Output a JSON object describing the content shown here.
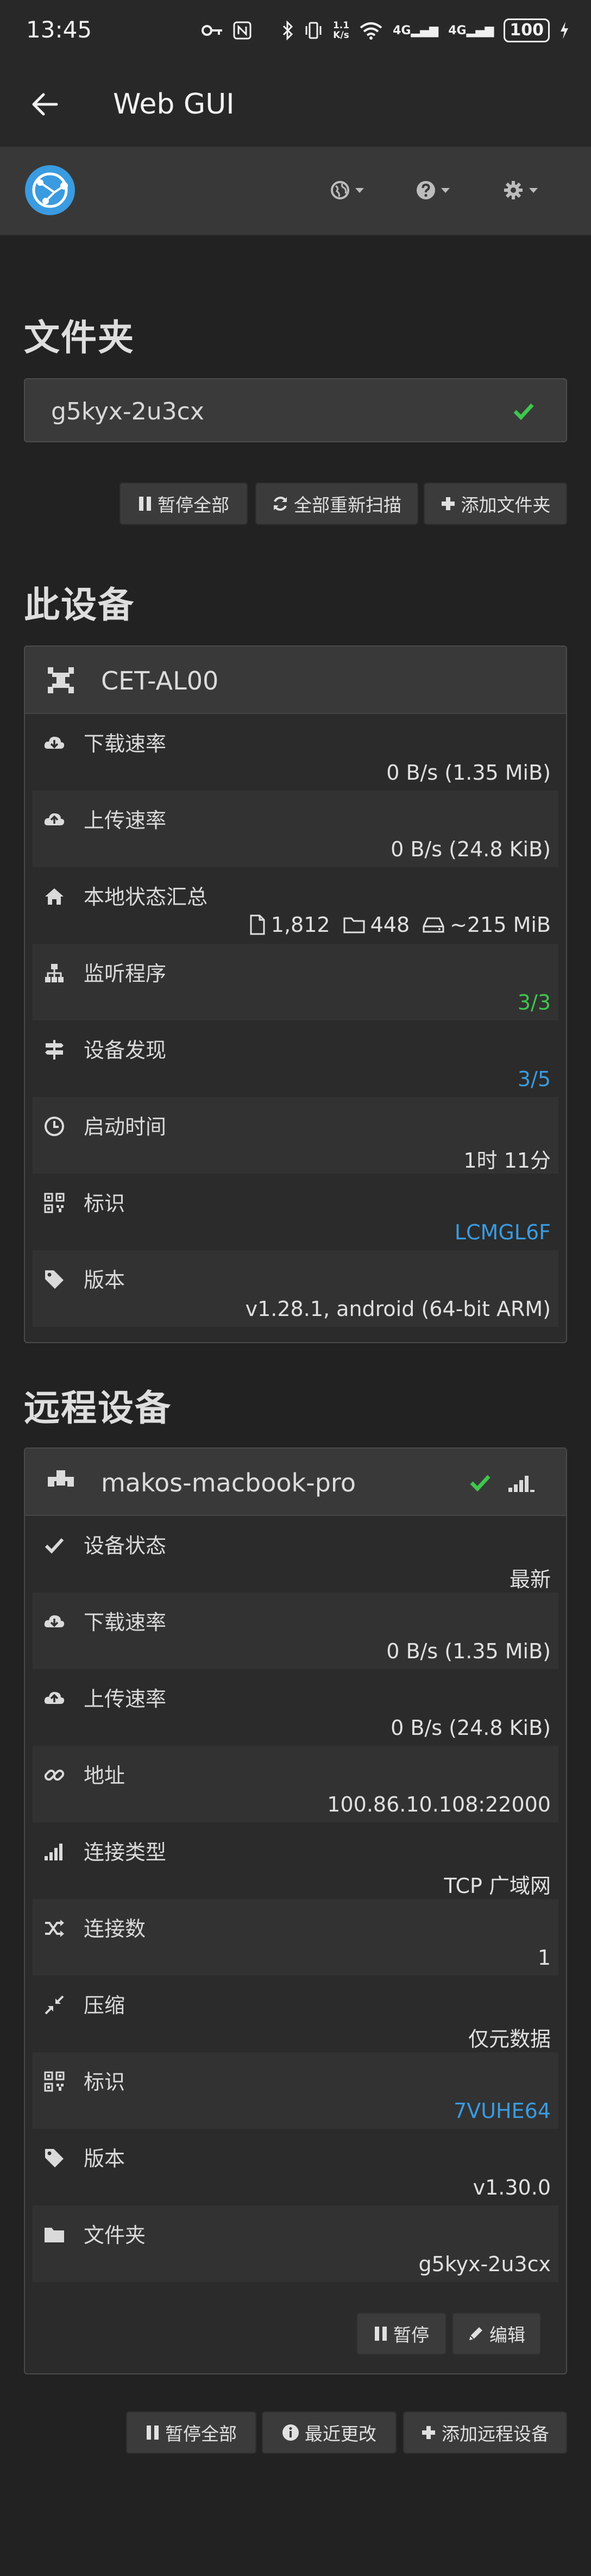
{
  "status_bar": {
    "time": "13:45",
    "net_speed_top": "1.1",
    "net_speed_bottom": "K/s",
    "signal_1": "4G",
    "signal_2": "4G",
    "battery": "100"
  },
  "app_bar": {
    "title": "Web GUI"
  },
  "navbar": {
    "icons": [
      "syncthing-logo",
      "globe-icon",
      "question-icon",
      "gear-icon"
    ]
  },
  "folders": {
    "heading": "文件夹",
    "items": [
      {
        "name": "g5kyx-2u3cx",
        "status_color": "#3fc64d"
      }
    ],
    "actions": {
      "pause_all": "暂停全部",
      "rescan_all": "全部重新扫描",
      "add_folder": "添加文件夹"
    }
  },
  "this_device": {
    "heading": "此设备",
    "name": "CET-AL00",
    "rows": {
      "download_label": "下载速率",
      "download_value": "0 B/s (1.35 MiB)",
      "upload_label": "上传速率",
      "upload_value": "0 B/s (24.8 KiB)",
      "local_state_label": "本地状态汇总",
      "files": "1,812",
      "dirs": "448",
      "size": "~215 MiB",
      "listeners_label": "监听程序",
      "listeners_value": "3/3",
      "discovery_label": "设备发现",
      "discovery_value": "3/5",
      "uptime_label": "启动时间",
      "uptime_value": "1时 11分",
      "id_label": "标识",
      "id_value": "LCMGL6F",
      "version_label": "版本",
      "version_value": "v1.28.1, android (64-bit ARM)"
    }
  },
  "remote_devices": {
    "heading": "远程设备",
    "device": {
      "name": "makos-macbook-pro",
      "rows": {
        "status_label": "设备状态",
        "status_value": "最新",
        "download_label": "下载速率",
        "download_value": "0 B/s (1.35 MiB)",
        "upload_label": "上传速率",
        "upload_value": "0 B/s (24.8 KiB)",
        "address_label": "地址",
        "address_value": "100.86.10.108:22000",
        "conn_type_label": "连接类型",
        "conn_type_value": "TCP 广域网",
        "connections_label": "连接数",
        "connections_value": "1",
        "compression_label": "压缩",
        "compression_value": "仅元数据",
        "id_label": "标识",
        "id_value": "7VUHE64",
        "version_label": "版本",
        "version_value": "v1.30.0",
        "folders_label": "文件夹",
        "folders_value": "g5kyx-2u3cx"
      },
      "actions": {
        "pause": "暂停",
        "edit": "编辑"
      }
    },
    "actions": {
      "pause_all": "暂停全部",
      "recent_changes": "最近更改",
      "add_remote": "添加远程设备"
    }
  },
  "colors": {
    "ok_green": "#3fc64d",
    "link_blue": "#3a9be0",
    "logo_blue": "#3a9be0"
  }
}
